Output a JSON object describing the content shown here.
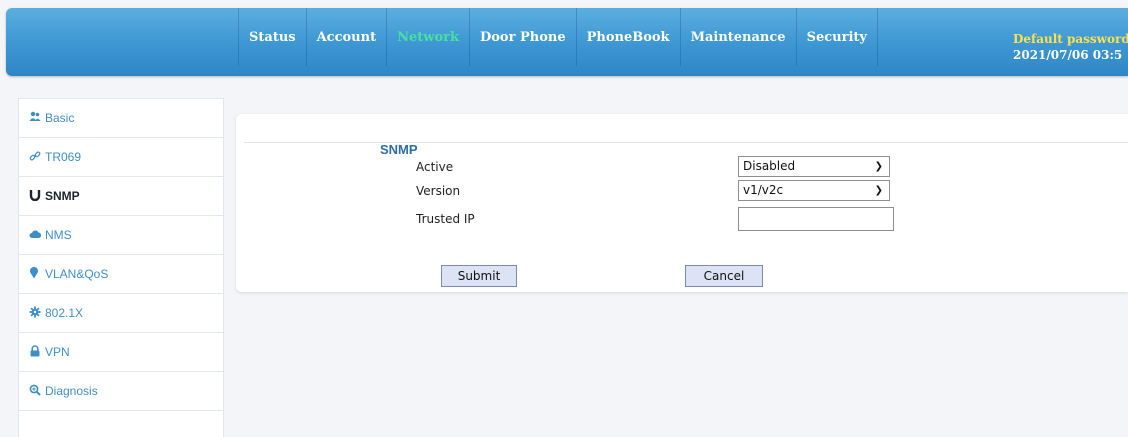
{
  "nav": {
    "items": [
      "Status",
      "Account",
      "Network",
      "Door Phone",
      "PhoneBook",
      "Maintenance",
      "Security"
    ],
    "active": "Network"
  },
  "header": {
    "warning": "Default password",
    "datetime": "2021/07/06 03:5"
  },
  "sidebar": {
    "items": [
      {
        "label": "Basic",
        "icon": "people-icon"
      },
      {
        "label": "TR069",
        "icon": "link-icon"
      },
      {
        "label": "SNMP",
        "icon": "magnet-icon"
      },
      {
        "label": "NMS",
        "icon": "cloud-icon"
      },
      {
        "label": "VLAN&QoS",
        "icon": "pin-icon"
      },
      {
        "label": "802.1X",
        "icon": "gear-icon"
      },
      {
        "label": "VPN",
        "icon": "lock-icon"
      },
      {
        "label": "Diagnosis",
        "icon": "magnifier-icon"
      }
    ],
    "active": "SNMP"
  },
  "panel": {
    "title": "SNMP",
    "fields": {
      "active_label": "Active",
      "active_value": "Disabled",
      "version_label": "Version",
      "version_value": "v1/v2c",
      "trusted_ip_label": "Trusted IP",
      "trusted_ip_value": ""
    },
    "submit_label": "Submit",
    "cancel_label": "Cancel"
  },
  "colors": {
    "header": "#3d96d2",
    "nav_active": "#48e0a0",
    "warning": "#ffe24a",
    "link": "#3e8fc8",
    "button": "#dbe3f5"
  }
}
